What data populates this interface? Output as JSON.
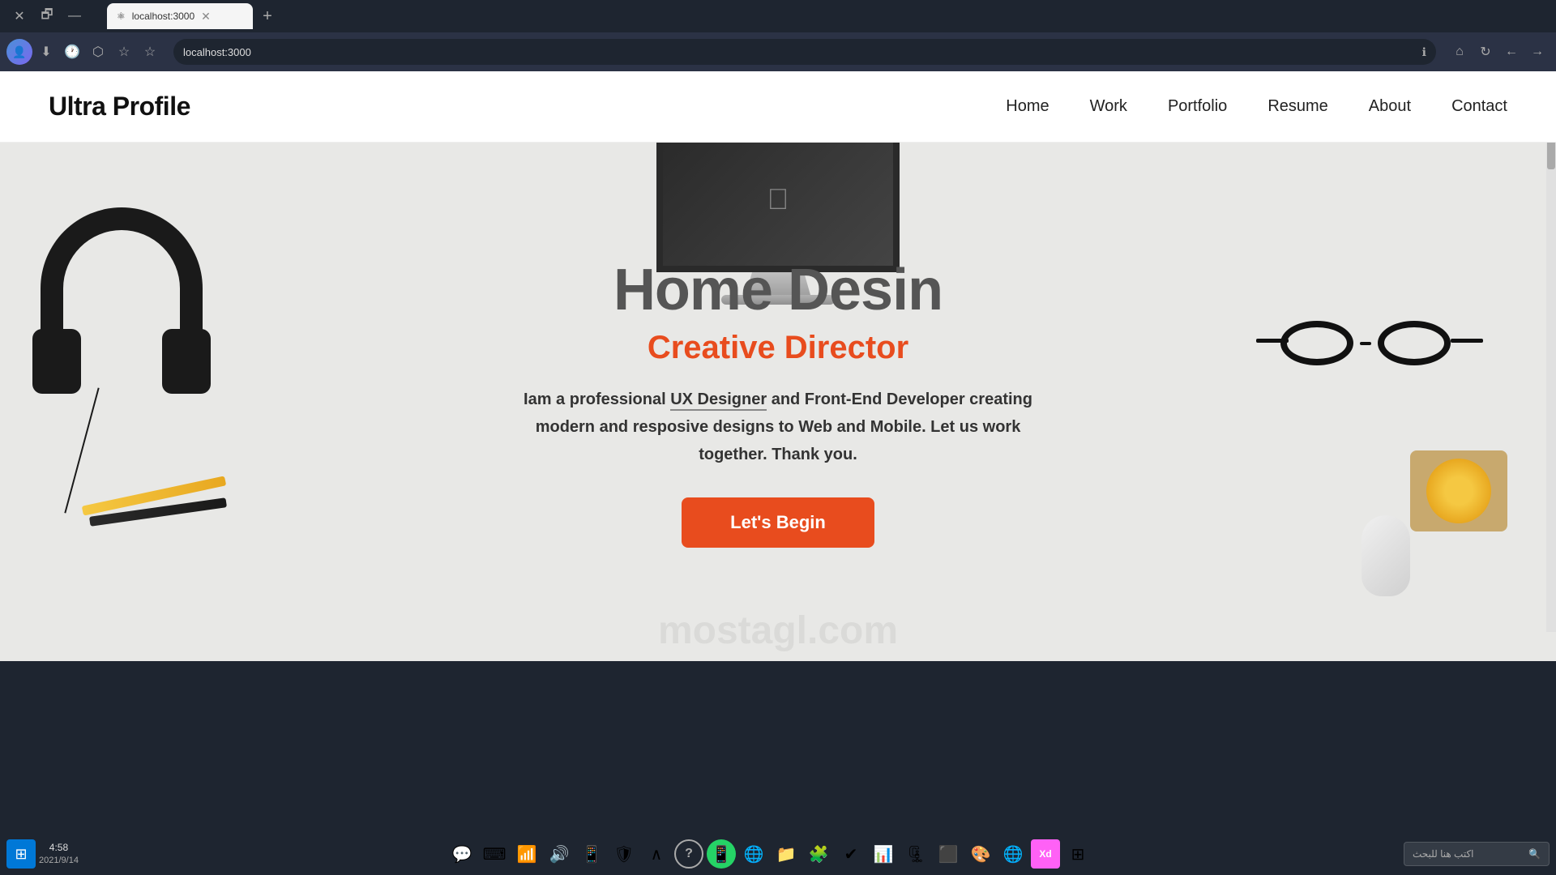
{
  "browser": {
    "title_bar": {
      "close_label": "✕",
      "minimize_label": "🗗",
      "maximize_label": "—"
    },
    "tabs": [
      {
        "label": "localhost:3000",
        "active": true,
        "icon": "⚛"
      }
    ],
    "tab_new_label": "+",
    "address": "localhost:3000",
    "nav_icons": {
      "back": "←",
      "forward": "→",
      "refresh": "↻",
      "home": "⌂",
      "info": "ℹ"
    }
  },
  "site": {
    "logo": "Ultra Profile",
    "nav": {
      "items": [
        "Home",
        "Work",
        "Portfolio",
        "Resume",
        "About",
        "Contact"
      ]
    },
    "hero": {
      "title": "Home Desin",
      "subtitle": "Creative Director",
      "description_prefix": "Iam a professional ",
      "description_highlight": "UX Designer",
      "description_suffix": " and Front-End Developer creating modern and resposive designs to Web and Mobile. Let us work together. Thank you.",
      "cta_label": "Let's Begin"
    },
    "watermark": "mostagl.com"
  },
  "taskbar": {
    "time": "4:58",
    "date": "2021/9/14",
    "search_placeholder": "اكتب هنا للبحث",
    "windows_icon": "⊞",
    "notification_icon": "💬"
  }
}
